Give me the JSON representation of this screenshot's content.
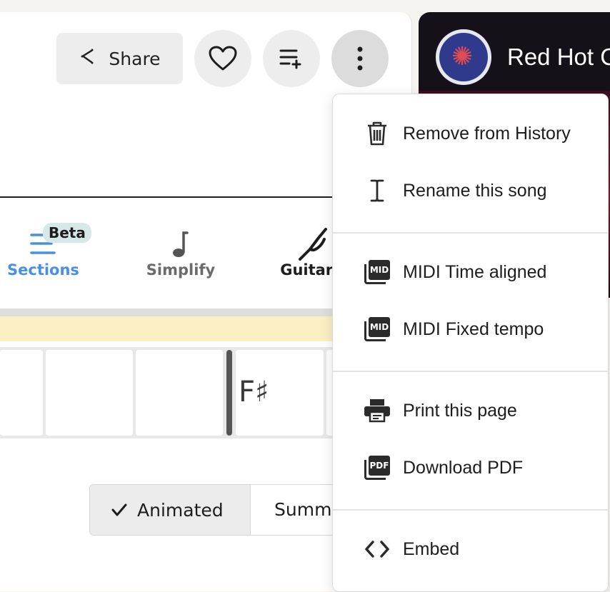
{
  "header": {
    "share_label": "Share",
    "video_title": "Red Hot C"
  },
  "tools": {
    "sections_label": "Sections",
    "beta_badge": "Beta",
    "simplify_label": "Simplify",
    "guitar_label": "Guitar T"
  },
  "chart": {
    "chord": "F♯"
  },
  "view_toggle": {
    "animated_label": "Animated",
    "summary_label": "Summ"
  },
  "menu": {
    "items": [
      {
        "label": "Remove from History",
        "icon": "trash-icon"
      },
      {
        "label": "Rename this song",
        "icon": "text-cursor-icon"
      },
      {
        "label": "MIDI Time aligned",
        "icon": "midi-icon"
      },
      {
        "label": "MIDI Fixed tempo",
        "icon": "midi-icon"
      },
      {
        "label": "Print this page",
        "icon": "printer-icon"
      },
      {
        "label": "Download PDF",
        "icon": "pdf-icon"
      },
      {
        "label": "Embed",
        "icon": "code-icon"
      }
    ],
    "midi_tag": "MID",
    "pdf_tag": "PDF"
  },
  "colors": {
    "accent": "#4a90e2",
    "beta_bg": "#d7e8e9",
    "highlight_band": "#fbefc4"
  }
}
